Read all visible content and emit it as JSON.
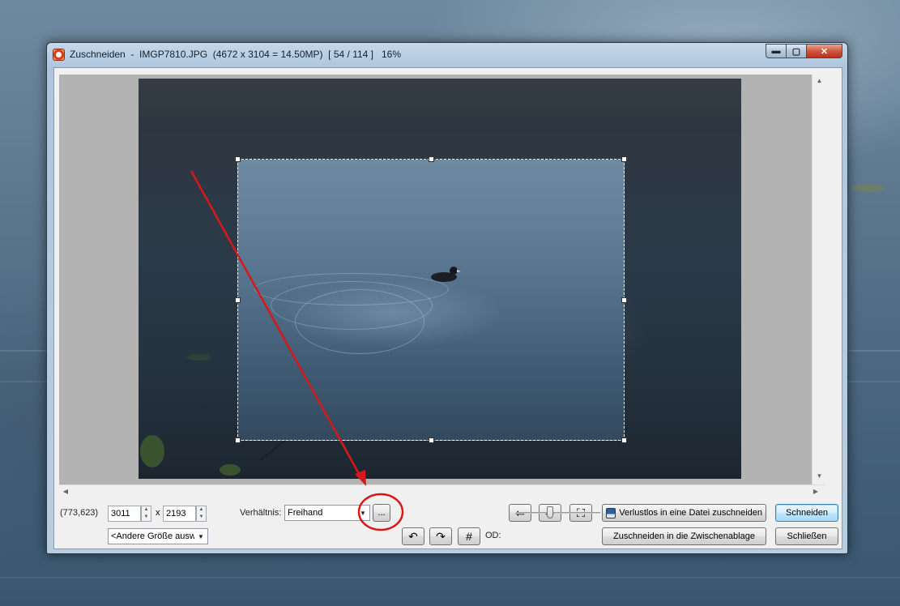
{
  "window": {
    "title": "Zuschneiden  -  IMGP7810.JPG  (4672 x 3104 = 14.50MP)  [ 54 / 114 ]   16%",
    "minimize_glyph": "▬",
    "maximize_glyph": "▢",
    "close_glyph": "✕"
  },
  "controls": {
    "coords": "(773,623)",
    "width_value": "3011",
    "height_value": "2193",
    "times": "x",
    "size_preset": "<Andere Größe ausw",
    "ratio_label": "Verhältnis:",
    "ratio_value": "Freihand",
    "more_button": "...",
    "od_label": "OD:",
    "od_slider": 0.4,
    "prev_glyph": "⇦",
    "next_glyph": "⇨",
    "fit_glyph": "⛶",
    "rotate_left_glyph": "↶",
    "rotate_right_glyph": "↷",
    "grid_glyph": "#",
    "lossless_crop_label": "Verlustlos in eine Datei zuschneiden",
    "clipboard_crop_label": "Zuschneiden in die Zwischenablage",
    "crop_button": "Schneiden",
    "close_button": "Schließen"
  },
  "icons": {
    "app": "app-icon",
    "save": "floppy-disk-icon",
    "prev": "arrow-left-icon",
    "next": "arrow-right-icon",
    "fit": "fit-frame-icon"
  },
  "colors": {
    "annotation": "#d81818",
    "default_button_border": "#3c7fb1"
  }
}
